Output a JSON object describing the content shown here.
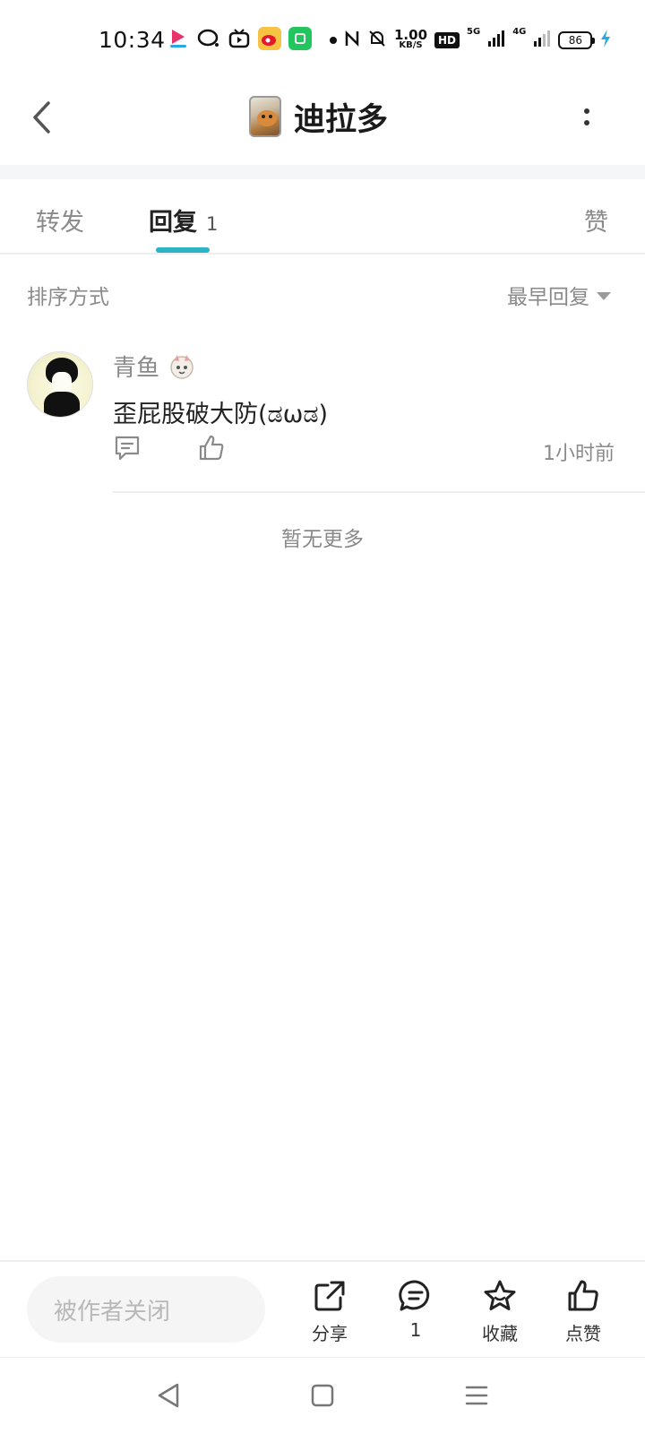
{
  "status_bar": {
    "time": "10:34",
    "net_speed_value": "1.00",
    "net_speed_unit": "KB/S",
    "hd": "HD",
    "signal_1": "5G",
    "signal_2": "4G",
    "battery": "86",
    "icons": [
      "video-app-icon",
      "qq-icon",
      "bilibili-tv-icon",
      "weibo-icon",
      "green-app-icon",
      "dot-icon",
      "nfc-icon",
      "mute-bell-icon",
      "signal-icon",
      "charging-icon"
    ]
  },
  "header": {
    "title": "迪拉多",
    "back_icon": "chevron-left-icon",
    "more_icon": "more-vertical-icon"
  },
  "tabs": {
    "forward": "转发",
    "reply": "回复",
    "reply_count": "1",
    "like": "赞",
    "accent_color": "#2cb3c6"
  },
  "sort": {
    "label": "排序方式",
    "selected": "最早回复"
  },
  "comments": [
    {
      "name": "青鱼",
      "text": "歪屁股破大防(ಡωಡ)",
      "time": "1小时前"
    }
  ],
  "footer_note": "暂无更多",
  "bottom_bar": {
    "input_placeholder": "被作者关闭",
    "share": "分享",
    "comment_count": "1",
    "favorite": "收藏",
    "like": "点赞"
  }
}
